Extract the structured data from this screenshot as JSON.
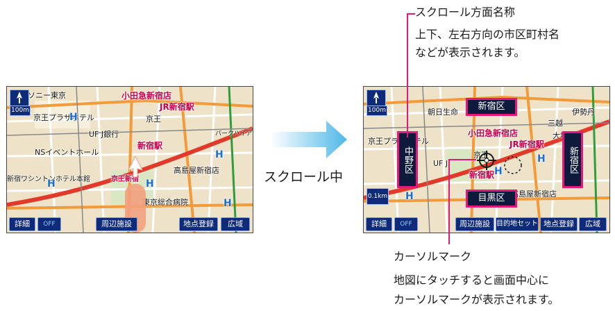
{
  "left_screen": {
    "scale": "100m",
    "labels_dark": [
      "ソニー東京",
      "京王プラザホテル",
      "UF J銀行",
      "京王",
      "NSイベントホール",
      "高島屋新宿店",
      "パークハイアット東京",
      "東京総合病院",
      "新宿ワシントンホテル本館"
    ],
    "labels_pink": [
      "小田急新宿店",
      "JR新宿駅",
      "新宿駅",
      "京王新宿"
    ],
    "toolbar": {
      "detail": "詳細",
      "off": "OFF",
      "nearby": "周辺施設",
      "register": "地点登録",
      "wide": "広域"
    }
  },
  "right_screen": {
    "scale": "100m",
    "scale_small": "0.1km",
    "labels_dark": [
      "朝日生命",
      "京王プラザホテル",
      "UF J",
      "高島屋新宿店",
      "伊勢丹",
      "三越",
      "大塚家具",
      "京王"
    ],
    "labels_pink": [
      "小田急新宿店",
      "JR新宿駅",
      "新宿駅"
    ],
    "direction_names": {
      "top": "新宿区",
      "left": "中野区",
      "right": "新宿区",
      "bottom": "目黒区"
    },
    "toolbar": {
      "detail": "詳細",
      "off": "OFF",
      "nearby": "周辺施設",
      "destination": "目的地セット",
      "register": "地点登録",
      "wide": "広域"
    }
  },
  "arrow_label": "スクロール中",
  "annotation_scroll": {
    "title": "スクロール方面名称",
    "line1": "上下、左右方向の市区町村名",
    "line2": "などが表示されます。"
  },
  "annotation_cursor": {
    "title": "カーソルマーク",
    "line1": "地図にタッチすると画面中心に",
    "line2": "カーソルマークが表示されます。"
  },
  "colors": {
    "accent": "#e0197a",
    "button_navy": "#0e2a78",
    "arrow_blue": "#4fb8e8",
    "road_orange": "#f39a3a",
    "road_red": "#e23a2a"
  }
}
